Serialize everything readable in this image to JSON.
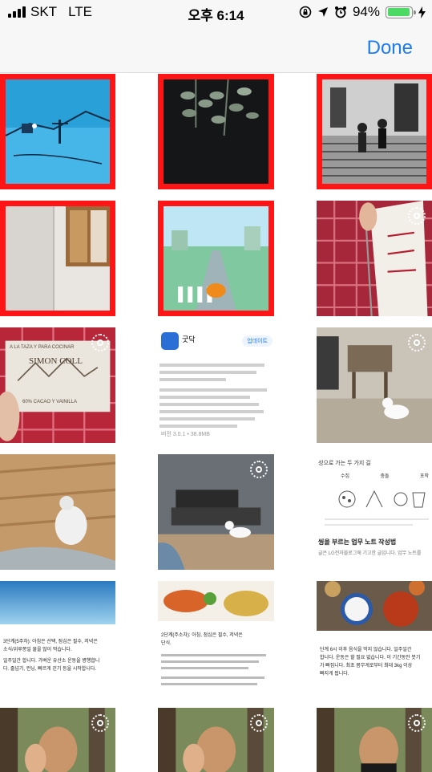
{
  "status_bar": {
    "carrier": "SKT",
    "network": "LTE",
    "time": "오후 6:14",
    "battery_percent": "94%",
    "battery_level": 0.94
  },
  "nav": {
    "done_label": "Done"
  },
  "tiles": [
    {
      "label": "blue illustration",
      "selected": true
    },
    {
      "label": "leaves on dark",
      "selected": true
    },
    {
      "label": "stairs crowd",
      "selected": true
    },
    {
      "label": "window wall",
      "selected": true
    },
    {
      "label": "illustration road",
      "selected": true
    },
    {
      "label": "book on red",
      "selected": false,
      "live": true
    },
    {
      "label": "chocolate box",
      "selected": false,
      "live": true,
      "text": [
        "SIMON COLL",
        "A LA TAZA Y PARA COCINAR",
        "60% CACAO Y VAINILLA"
      ]
    },
    {
      "label": "app update screen",
      "selected": false,
      "text": {
        "name": "굿닥",
        "update": "업데이트",
        "version_line": "버전 3.0.1 • 38.8MB"
      }
    },
    {
      "label": "white dog indoor",
      "selected": false,
      "live": true
    },
    {
      "label": "hamster",
      "selected": false
    },
    {
      "label": "dog living room",
      "selected": false,
      "live": true
    },
    {
      "label": "infographic",
      "selected": false,
      "text": {
        "heading": "성으로 가는 두 가지 길",
        "cols": [
          "수집",
          "충돌",
          "포착"
        ],
        "title": "씽을 부르는 업무 노트 작성법",
        "sub": "글은 LG전자블로그에 기고한 글입니다. 업무 노트를"
      }
    },
    {
      "label": "water glass post",
      "selected": false,
      "text": [
        "3단계(5주차): 아침은 선택, 점심은 필수, 저녁은",
        "소식/위루쫑일 물을 많이 먹습니다.",
        "일주일간 합니다. 가벼운 유산소 운동을 병행합니",
        "다. 줄넘기, 런닝, 빠르게 걷기 등을 시작합니다."
      ]
    },
    {
      "label": "food post",
      "selected": false,
      "text": [
        "2단계(주소차): 아침, 점심은 필수, 저녁은",
        "단식."
      ]
    },
    {
      "label": "korean meal post",
      "selected": false,
      "text": [
        "단계 6시 이후 음식을 먹지 않습니다. 일주일간",
        "합니다. 운동은 할 필요 없습니다. 이 기간동안 붓기",
        "가 빠집니다. 최초 몸무게로부터 최대 3kg 이상",
        "빠지게 됩니다."
      ]
    },
    {
      "label": "man selfie 1",
      "selected": false,
      "live": true
    },
    {
      "label": "man selfie 2",
      "selected": false,
      "live": true
    },
    {
      "label": "man selfie 3",
      "selected": false,
      "live": true
    }
  ]
}
